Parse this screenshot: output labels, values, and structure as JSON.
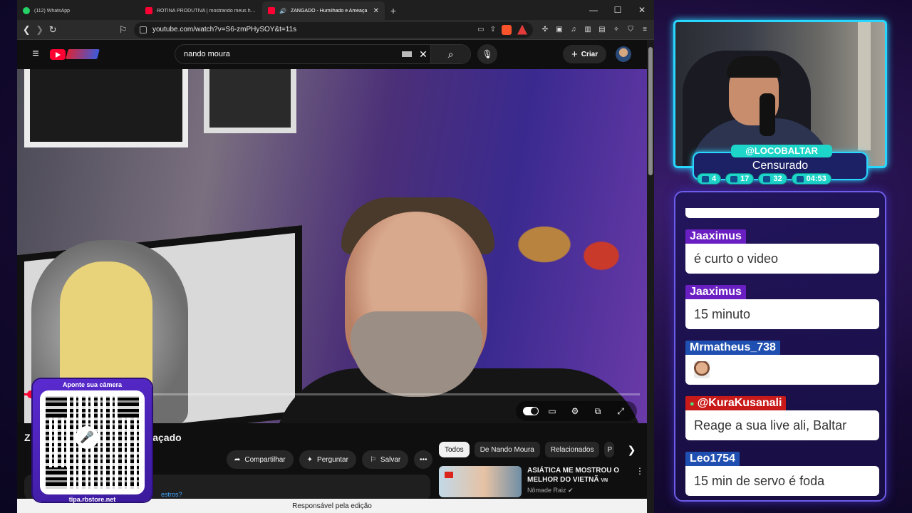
{
  "browser": {
    "tabs": [
      {
        "title": "(112) WhatsApp",
        "favicon": "whatsapp-icon"
      },
      {
        "title": "ROTINA PRODUTIVA | mostrando meus hábi",
        "favicon": "youtube-icon"
      },
      {
        "title": "ZANGADO - Humilhado e Ameaça",
        "favicon": "youtube-icon"
      }
    ],
    "url": "youtube.com/watch?v=S6-zmPHySOY&t=11s"
  },
  "youtube": {
    "search_query": "nando moura",
    "create_label": "Criar",
    "video_title": "Z",
    "video_title_tail": "eaçado",
    "actions": {
      "share": "Compartilhar",
      "ask": "Perguntar",
      "save": "Salvar"
    },
    "progress_fraction": 0.01,
    "chips": [
      "Todos",
      "De Nando Moura",
      "Relacionados",
      "P"
    ],
    "recommendation": {
      "title": "ASIÁTICA ME MOSTROU O MELHOR DO VIETNÃ",
      "flag_label": "VN",
      "channel": "Nômade Raiz"
    },
    "comment_tail": "estros?",
    "footer": "Responsável pela edição"
  },
  "qr": {
    "caption": "Aponte sua câmera",
    "site": "tipa.rbstore.net"
  },
  "stream": {
    "username": "@LOCOBALTAR",
    "title": "Censurado",
    "stats": [
      {
        "icon": "twitch-icon",
        "value": "4"
      },
      {
        "icon": "youtube-icon",
        "value": "17"
      },
      {
        "icon": "kick-icon",
        "value": "32"
      },
      {
        "icon": "clock-icon",
        "value": "04:53"
      }
    ],
    "accent": "#28d7ff"
  },
  "chat": {
    "messages": [
      {
        "user": "Jaaximus",
        "text": "é curto o video",
        "color": "#6a1fc2"
      },
      {
        "user": "Jaaximus",
        "text": "15 minuto",
        "color": "#6a1fc2"
      },
      {
        "user": "Mrmatheus_738",
        "text": "",
        "emote": true,
        "color": "#1f4fb0"
      },
      {
        "user": "@KuraKusanali",
        "text": "Reage a sua live ali, Baltar",
        "color": "#c91a1a"
      },
      {
        "user": "Leo1754",
        "text": "15 min de servo é foda",
        "color": "#1f4fb0"
      }
    ]
  }
}
